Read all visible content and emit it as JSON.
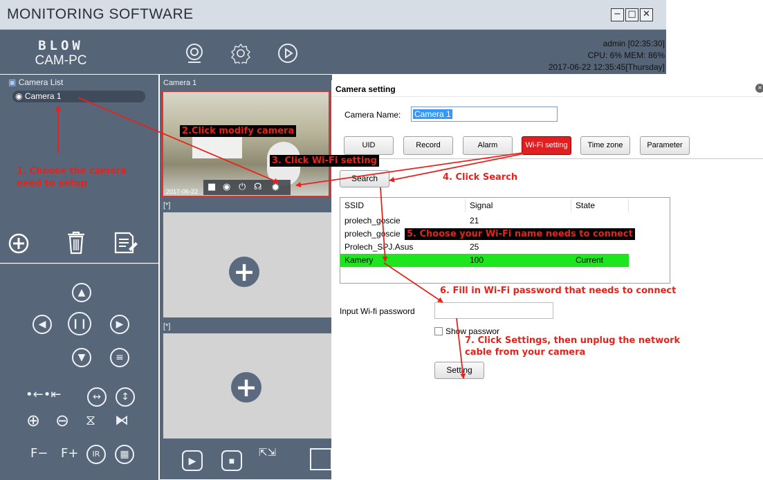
{
  "app": {
    "title": "MONITORING SOFTWARE",
    "win_buttons": [
      "−",
      "□",
      "✕"
    ]
  },
  "brand": {
    "logo": "BLOW",
    "subtitle": "CAM-PC"
  },
  "header_icons": [
    "webcam-icon",
    "gear-icon",
    "play-icon"
  ],
  "status": {
    "line1": "admin  [02:35:30]",
    "line2": "CPU: 6%  MEM: 86%",
    "line3": "2017-06-22 12:35:45[Thursday]"
  },
  "camera_list": {
    "title": "Camera List",
    "items": [
      "Camera 1"
    ]
  },
  "panes": {
    "pane1_label": "Camera 1",
    "pane2_label": "[*]",
    "pane3_label": "[*]",
    "timestamp": "2017-06-22"
  },
  "dialog": {
    "title": "Camera setting",
    "camera_name_label": "Camera Name:",
    "camera_name_value": "Camera 1",
    "tabs": [
      "UID",
      "Record",
      "Alarm",
      "Wi-Fi setting",
      "Time zone",
      "Parameter"
    ],
    "active_tab": "Wi-Fi setting",
    "search_label": "Search",
    "table": {
      "headers": [
        "SSID",
        "Signal",
        "State"
      ],
      "rows": [
        {
          "ssid": "prolech_goscie",
          "signal": "21",
          "state": ""
        },
        {
          "ssid": "prolech_goscie",
          "signal": "",
          "state": ""
        },
        {
          "ssid": "Prolech_SPJ.Asus",
          "signal": "25",
          "state": ""
        },
        {
          "ssid": "Kamery",
          "signal": "100",
          "state": "Current"
        }
      ],
      "selected_row": 3
    },
    "password_label": "Input Wi-fi password",
    "password_value": "",
    "show_password_label": "Show passwor",
    "show_password_checked": false,
    "setting_label": "Setting"
  },
  "annotations": {
    "a1": "1. Choose the camera",
    "a1b": "need to setup",
    "a2": "2.Click modify camera",
    "a3": "3. Click Wi-Fi setting",
    "a4": "4. Click Search",
    "a5": "5. Choose your Wi-Fi name needs to connect",
    "a6": "6. Fill in Wi-Fi password that needs to connect",
    "a7": "7. Click Settings, then unplug the network",
    "a7b": "cable from your camera"
  },
  "controls": {
    "zoom_labels": [
      "F−",
      "F+",
      "IR"
    ]
  },
  "colors": {
    "accent_red": "#e8221b",
    "panel": "#586679",
    "selected_row": "#1ee61e"
  }
}
